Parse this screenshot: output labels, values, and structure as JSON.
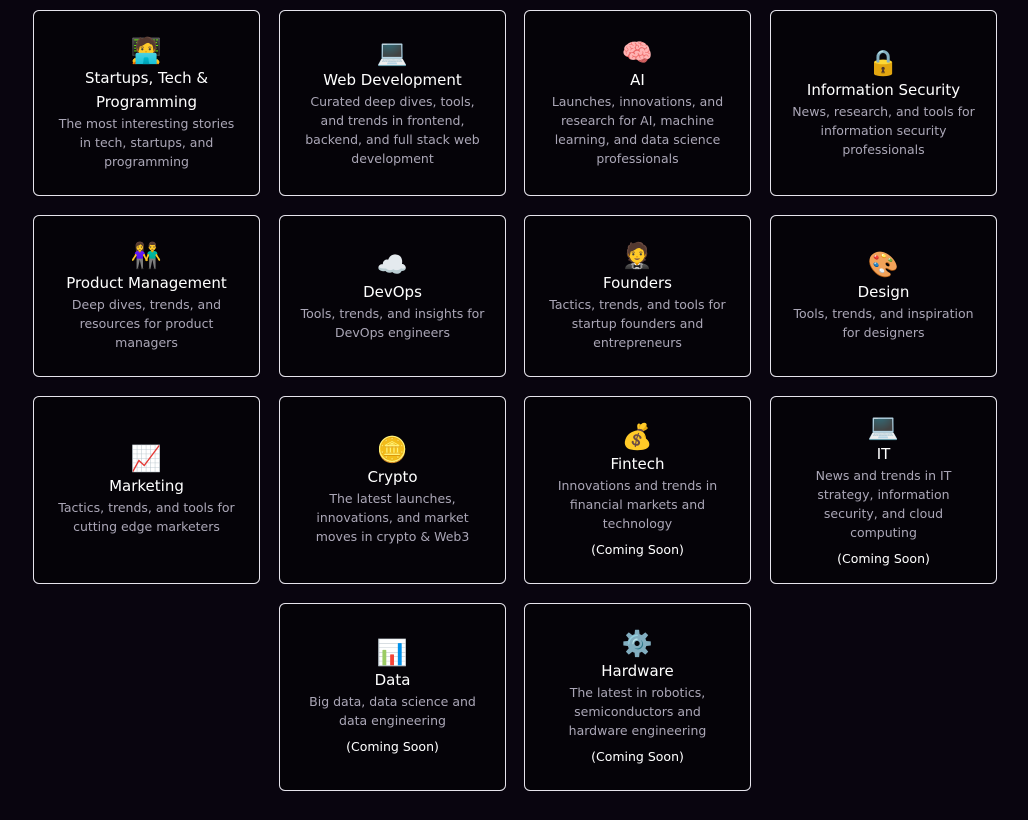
{
  "cards": [
    {
      "emoji": "🧑‍💻",
      "icon_name": "technologist-icon",
      "title": "Startups, Tech & Programming",
      "description": "The most interesting stories in tech, startups, and programming",
      "badge": ""
    },
    {
      "emoji": "💻",
      "icon_name": "laptop-icon",
      "title": "Web Development",
      "description": "Curated deep dives, tools, and trends in frontend, backend, and full stack web development",
      "badge": ""
    },
    {
      "emoji": "🧠",
      "icon_name": "brain-icon",
      "title": "AI",
      "description": "Launches, innovations, and research for AI, machine learning, and data science professionals",
      "badge": ""
    },
    {
      "emoji": "🔒",
      "icon_name": "lock-icon",
      "title": "Information Security",
      "description": "News, research, and tools for information security professionals",
      "badge": ""
    },
    {
      "emoji": "👫",
      "icon_name": "people-icon",
      "title": "Product Management",
      "description": "Deep dives, trends, and resources for product managers",
      "badge": ""
    },
    {
      "emoji": "☁️",
      "icon_name": "cloud-icon",
      "title": "DevOps",
      "description": "Tools, trends, and insights for DevOps engineers",
      "badge": ""
    },
    {
      "emoji": "🤵",
      "icon_name": "person-in-suit-icon",
      "title": "Founders",
      "description": "Tactics, trends, and tools for startup founders and entrepreneurs",
      "badge": ""
    },
    {
      "emoji": "🎨",
      "icon_name": "palette-icon",
      "title": "Design",
      "description": "Tools, trends, and inspiration for designers",
      "badge": ""
    },
    {
      "emoji": "📈",
      "icon_name": "chart-increasing-icon",
      "title": "Marketing",
      "description": "Tactics, trends, and tools for cutting edge marketers",
      "badge": ""
    },
    {
      "emoji": "🪙",
      "icon_name": "coin-icon",
      "title": "Crypto",
      "description": "The latest launches, innovations, and market moves in crypto & Web3",
      "badge": ""
    },
    {
      "emoji": "💰",
      "icon_name": "money-bag-icon",
      "title": "Fintech",
      "description": "Innovations and trends in financial markets and technology",
      "badge": "(Coming Soon)"
    },
    {
      "emoji": "💻",
      "icon_name": "laptop-icon",
      "title": "IT",
      "description": "News and trends in IT strategy, information security, and cloud computing",
      "badge": "(Coming Soon)"
    },
    {
      "emoji": "📊",
      "icon_name": "bar-chart-icon",
      "title": "Data",
      "description": "Big data, data science and data engineering",
      "badge": "(Coming Soon)"
    },
    {
      "emoji": "⚙️",
      "icon_name": "gear-icon",
      "title": "Hardware",
      "description": "The latest in robotics, semiconductors and hardware engineering",
      "badge": "(Coming Soon)"
    }
  ]
}
